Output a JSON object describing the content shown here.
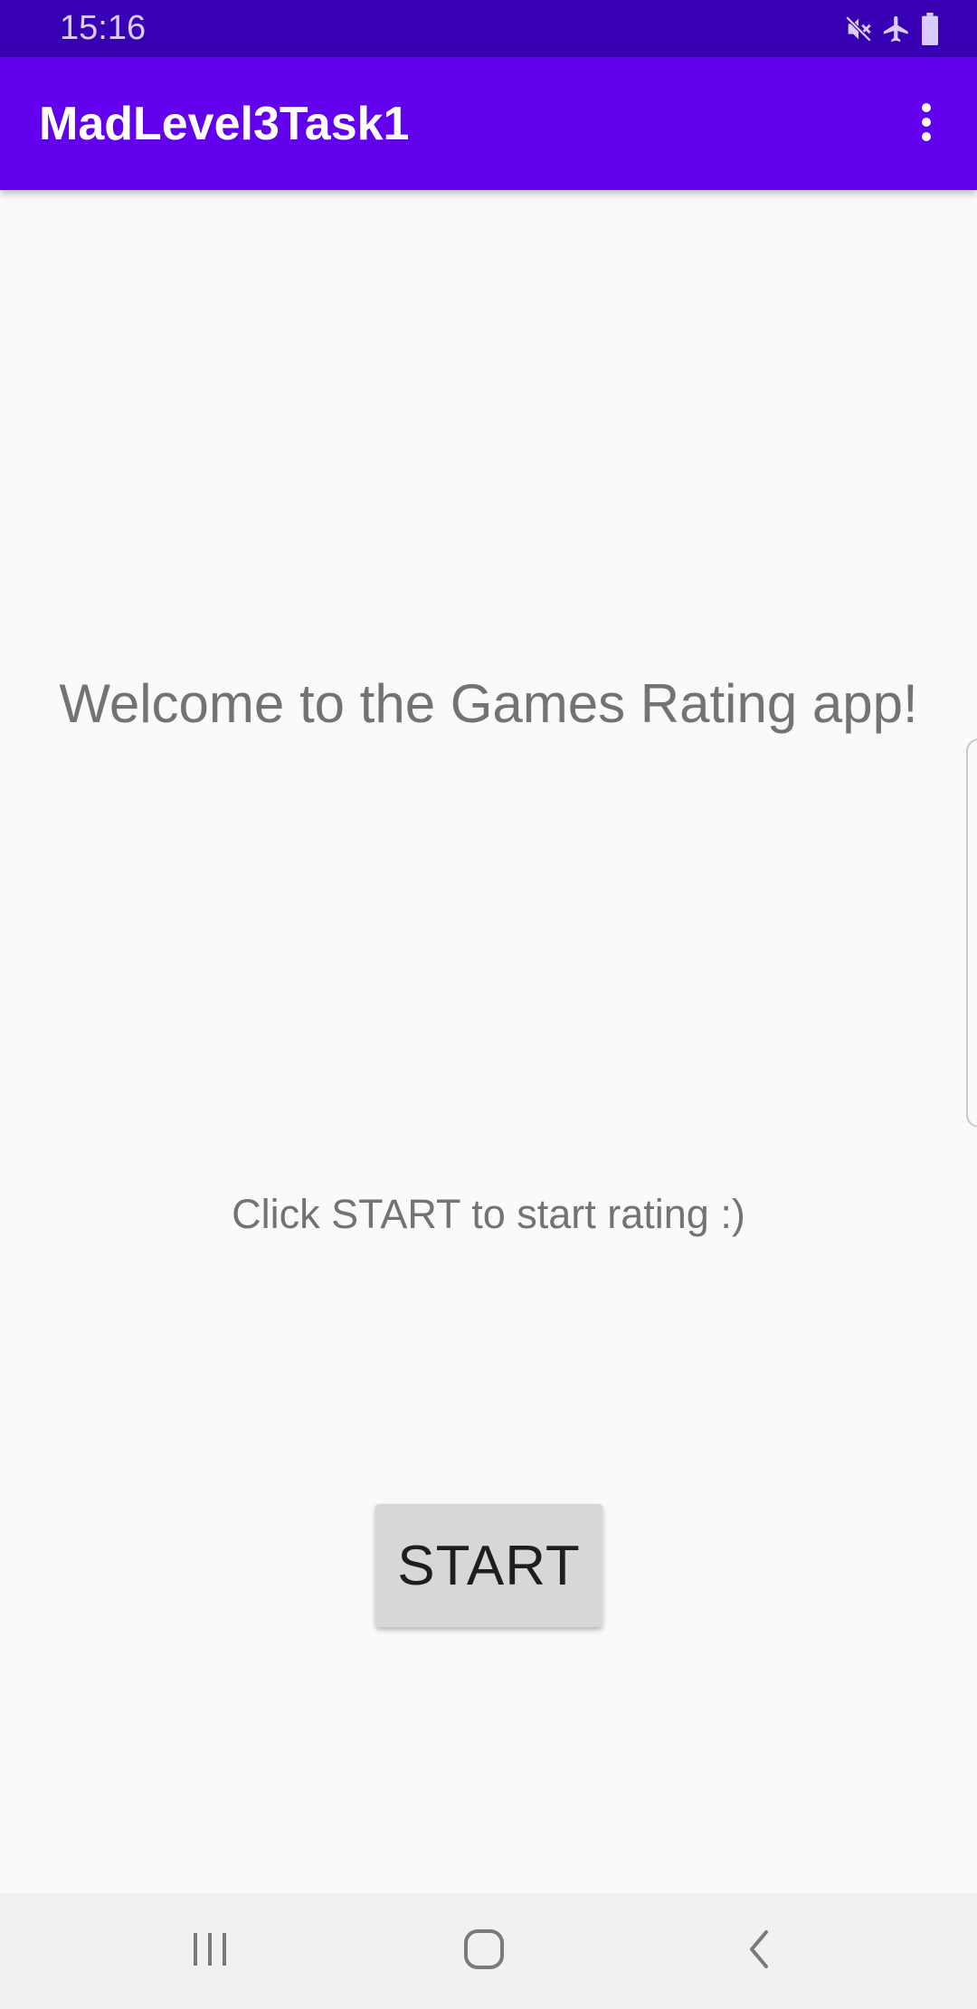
{
  "status_bar": {
    "time": "15:16",
    "icons": [
      "mute-icon",
      "airplane-mode-icon",
      "battery-icon"
    ],
    "background_color": "#3700b3"
  },
  "app_bar": {
    "title": "MadLevel3Task1",
    "overflow_icon": "more-vert-icon",
    "background_color": "#6200ee"
  },
  "main": {
    "welcome_text": "Welcome to the Games Rating app!",
    "instruction_text": "Click START to start rating :)",
    "start_button_label": "START"
  },
  "nav_bar": {
    "icons": [
      "recents-icon",
      "home-icon",
      "back-icon"
    ]
  }
}
